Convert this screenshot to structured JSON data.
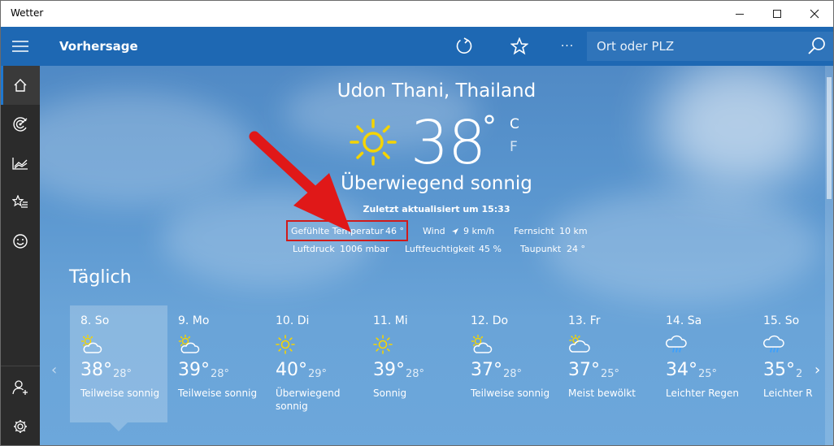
{
  "window": {
    "title": "Wetter",
    "controls": {
      "minimize": "minimize-icon",
      "maximize": "maximize-icon",
      "close": "close-icon"
    }
  },
  "sidebar": {
    "items": [
      {
        "icon": "hamburger-menu-icon"
      },
      {
        "icon": "home-icon",
        "selected": true
      },
      {
        "icon": "radar-maps-icon"
      },
      {
        "icon": "historical-weather-icon"
      },
      {
        "icon": "favorites-list-icon"
      },
      {
        "icon": "smiley-news-icon"
      },
      {
        "icon": "account-icon"
      },
      {
        "icon": "settings-gear-icon"
      }
    ]
  },
  "appbar": {
    "heading": "Vorhersage",
    "search_placeholder": "Ort oder PLZ",
    "icons": [
      "refresh-icon",
      "star-favorite-icon",
      "more-icon",
      "search-icon"
    ],
    "more_label": "···"
  },
  "current": {
    "location": "Udon Thani, Thailand",
    "temperature": "38",
    "degree": "°",
    "unit_c": "C",
    "unit_f": "F",
    "condition": "Überwiegend sonnig",
    "updated": "Zuletzt aktualisiert um 15:33",
    "details": {
      "feels_like_label": "Gefühlte Temperatur",
      "feels_like_value": "46 °",
      "wind_label": "Wind",
      "wind_value": "9 km/h",
      "visibility_label": "Fernsicht",
      "visibility_value": "10 km",
      "pressure_label": "Luftdruck",
      "pressure_value": "1006 mbar",
      "humidity_label": "Luftfeuchtigkeit",
      "humidity_value": "45 %",
      "dewpoint_label": "Taupunkt",
      "dewpoint_value": "24 °"
    }
  },
  "daily": {
    "title": "Täglich",
    "days": [
      {
        "name": "8. So",
        "icon": "partly-sunny-icon",
        "high": "38°",
        "low": "28°",
        "desc": "Teilweise sonnig"
      },
      {
        "name": "9. Mo",
        "icon": "partly-sunny-icon",
        "high": "39°",
        "low": "28°",
        "desc": "Teilweise sonnig"
      },
      {
        "name": "10. Di",
        "icon": "sunny-icon",
        "high": "40°",
        "low": "29°",
        "desc": "Überwiegend sonnig"
      },
      {
        "name": "11. Mi",
        "icon": "sunny-icon",
        "high": "39°",
        "low": "28°",
        "desc": "Sonnig"
      },
      {
        "name": "12. Do",
        "icon": "partly-sunny-icon",
        "high": "37°",
        "low": "28°",
        "desc": "Teilweise sonnig"
      },
      {
        "name": "13. Fr",
        "icon": "mostly-cloudy-icon",
        "high": "37°",
        "low": "25°",
        "desc": "Meist bewölkt"
      },
      {
        "name": "14. Sa",
        "icon": "light-rain-icon",
        "high": "34°",
        "low": "25°",
        "desc": "Leichter Regen"
      },
      {
        "name": "15. So",
        "icon": "light-rain-icon",
        "high": "35°",
        "low": "2",
        "desc": "Leichter R"
      }
    ],
    "nav_prev": "‹",
    "nav_next": "›"
  },
  "colors": {
    "sidebar": "#2b2b2b",
    "appbar": "#1e68b3",
    "highlight_box": "#d11a1a",
    "arrow": "#e01818",
    "sun": "#f5d400"
  }
}
